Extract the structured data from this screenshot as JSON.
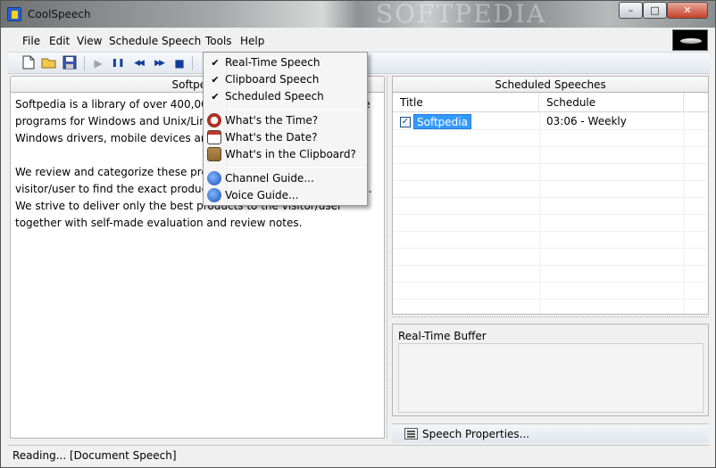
{
  "window": {
    "title": "CoolSpeech",
    "watermark": "SOFTPEDIA"
  },
  "caption_buttons": {
    "minimize": "–",
    "maximize": "□",
    "close": "✕"
  },
  "menubar": {
    "items": [
      "File",
      "Edit",
      "View",
      "Schedule",
      "Speech",
      "Tools",
      "Help"
    ]
  },
  "toolbar": {
    "buttons": [
      "new-document-icon",
      "open-folder-icon",
      "save-icon",
      "play-icon",
      "pause-icon",
      "rewind-icon",
      "fast-forward-icon",
      "stop-icon"
    ],
    "glyphs": {
      "play": "▶",
      "pause": "❚❚",
      "rewind": "◀◀",
      "forward": "▶▶",
      "stop": "■"
    }
  },
  "document_pane": {
    "header": "Softpedia",
    "paragraphs": [
      "Softpedia is a library of over 400,000 free and free-to-try software programs for Windows and Unix/Linux, games, Mac software, Windows drivers, mobile devices and IT-related articles.",
      "We review and categorize these products in order to allow the visitor/user to find the exact product they and their system needs. We strive to deliver only the best products to the visitor/user together with self-made evaluation and review notes."
    ]
  },
  "scheduled_pane": {
    "header": "Scheduled Speeches",
    "columns": [
      "Title",
      "Schedule"
    ],
    "rows": [
      {
        "checked": true,
        "title": "Softpedia",
        "schedule": "03:06 - Weekly"
      }
    ]
  },
  "realtime_buffer": {
    "label": "Real-Time Buffer",
    "value": ""
  },
  "speech_properties_button": "Speech Properties...",
  "status_bar": {
    "text": "Reading... [Document Speech]"
  },
  "tools_menu": {
    "items": [
      {
        "label": "Real-Time Speech",
        "checked": true
      },
      {
        "label": "Clipboard Speech",
        "checked": true
      },
      {
        "label": "Scheduled Speech",
        "checked": true
      },
      {
        "label": "What's the Time?",
        "icon": "clock-icon"
      },
      {
        "label": "What's the Date?",
        "icon": "calendar-icon"
      },
      {
        "label": "What's in the Clipboard?",
        "icon": "clipboard-icon"
      },
      {
        "label": "Channel Guide...",
        "icon": "ie-globe-icon"
      },
      {
        "label": "Voice Guide...",
        "icon": "ie-globe-icon"
      }
    ],
    "check_glyph": "✔"
  },
  "colors": {
    "selection": "#3399ff",
    "toolbar_icon": "#123d9b"
  }
}
